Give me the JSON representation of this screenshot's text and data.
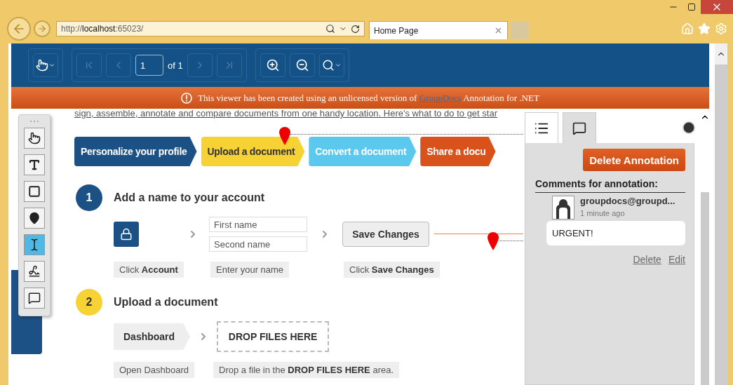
{
  "browser": {
    "address": "http://**localhost**:65023/",
    "tab_title": "Home Page"
  },
  "viewer_toolbar": {
    "page_input": "1",
    "page_count": "of 1"
  },
  "banner": {
    "text_before": "This viewer has been created using an unlicensed version of",
    "link": "GroupDocs",
    "text_after": "Annotation for .NET"
  },
  "tools": [
    {
      "kind": "hand",
      "selected": false
    },
    {
      "kind": "text",
      "selected": false
    },
    {
      "kind": "rectangle",
      "selected": false
    },
    {
      "kind": "point",
      "selected": false
    },
    {
      "kind": "strikeout",
      "selected": true
    },
    {
      "kind": "draw",
      "selected": false
    },
    {
      "kind": "comment",
      "selected": false
    }
  ],
  "document": {
    "intro": "sign, assemble, annotate and compare documents from one handy location. Here's what to do to get star",
    "steps": [
      {
        "label": "Personalize your profile",
        "color": "#1b5185"
      },
      {
        "label": "Upload a document",
        "color": "#f7d234"
      },
      {
        "label": "Convert a document",
        "color": "#5bc8ee"
      },
      {
        "label": "Share a docu",
        "color": "#d9521c"
      }
    ],
    "sections": [
      {
        "number": "1",
        "color": "#1b5185",
        "title": "Add a name to your account"
      },
      {
        "number": "2",
        "color": "#f7d234",
        "title": "Upload a document"
      }
    ],
    "account_caption": "Click **Account**",
    "name_fields": [
      "First name",
      "Second name"
    ],
    "name_caption": "Enter your name",
    "save_button": "Save Changes",
    "save_caption": "Click **Save Changes**",
    "dashboard_button": "Dashboard",
    "drop_zone": "DROP FILES HERE",
    "dashboard_caption": "Open Dashboard",
    "drop_caption": "Drop a file in the **DROP FILES HERE** area."
  },
  "panel": {
    "tabs": [
      {
        "kind": "list",
        "selected": false
      },
      {
        "kind": "comment",
        "selected": true
      }
    ],
    "delete_button": "Delete Annotation",
    "heading": "Comments for annotation:",
    "comments": [
      {
        "author": "groupdocs@groupd...",
        "time": "1 minute ago",
        "text": "URGENT!"
      }
    ],
    "actions": [
      "Delete",
      "Edit"
    ]
  }
}
